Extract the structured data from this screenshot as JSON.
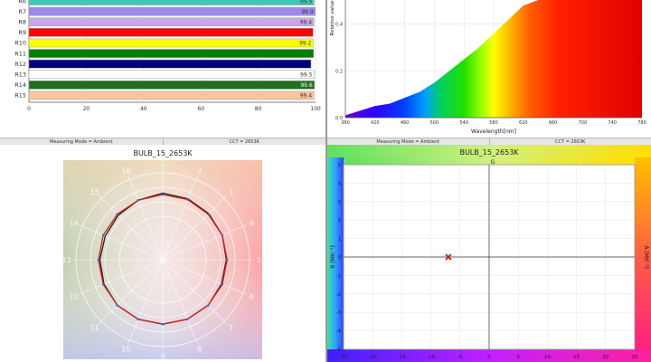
{
  "cri_chart": {
    "chart_data": {
      "type": "bar",
      "orientation": "horizontal",
      "categories": [
        "R6",
        "R7",
        "R8",
        "R9",
        "R10",
        "R11",
        "R12",
        "R13",
        "R14",
        "R15"
      ],
      "values": [
        99.5,
        99.9,
        99.4,
        99.1,
        99.2,
        99.3,
        98.4,
        99.5,
        99.6,
        99.4
      ],
      "value_labels": [
        "99.5",
        "99.9",
        "99.4",
        "",
        "99.2",
        "",
        "",
        "99.5",
        "99.6",
        "99.4"
      ],
      "colors": [
        "#40c8b4",
        "#9b8ae8",
        "#c7a8e8",
        "#ff0000",
        "#ffff00",
        "#008000",
        "#000080",
        "#ffffff",
        "#207020",
        "#f7c79c"
      ],
      "xlim": [
        0,
        100
      ],
      "xticks": [
        "0",
        "20",
        "40",
        "60",
        "80",
        "100"
      ]
    }
  },
  "spd_chart": {
    "chart_data": {
      "type": "area",
      "x": [
        380,
        400,
        420,
        440,
        460,
        480,
        500,
        520,
        540,
        560,
        580,
        600,
        620,
        640,
        660,
        680,
        700,
        720,
        740,
        760,
        780
      ],
      "y": [
        0.01,
        0.03,
        0.05,
        0.06,
        0.085,
        0.11,
        0.15,
        0.2,
        0.25,
        0.3,
        0.36,
        0.42,
        0.48,
        0.54,
        0.58,
        0.62,
        0.66,
        0.7,
        0.72,
        0.74,
        0.76
      ],
      "xlim": [
        380,
        780
      ],
      "ylim": [
        0,
        0.55
      ],
      "xticks": [
        "380",
        "420",
        "460",
        "500",
        "540",
        "580",
        "620",
        "660",
        "700",
        "740",
        "780"
      ],
      "yticks": [
        "0.0",
        "0.2",
        "0.4"
      ],
      "xlabel": "Wavelength[nm]",
      "ylabel": "Relative value"
    }
  },
  "status_left": {
    "mode": "Measuring Mode = Ambient",
    "cct": "CCT = 2653K"
  },
  "status_right": {
    "mode": "Measuring Mode = Ambient",
    "cct": "CCT = 2653K"
  },
  "cqs_chart": {
    "title": "BULB_15_2653K",
    "spokes": [
      "1",
      "2",
      "3",
      "4",
      "5",
      "6",
      "7",
      "8",
      "9",
      "10",
      "11",
      "12",
      "13",
      "14",
      "15",
      "16"
    ],
    "chart_data": {
      "type": "scatter",
      "series": [
        {
          "values": [
            0.92,
            0.91,
            0.9,
            0.89,
            0.88,
            0.88,
            0.89,
            0.89,
            0.89,
            0.89,
            0.89,
            0.88,
            0.87,
            0.86,
            0.87,
            0.89
          ]
        },
        {
          "values": [
            0.9,
            0.9,
            0.89,
            0.89,
            0.89,
            0.89,
            0.89,
            0.89,
            0.89,
            0.89,
            0.89,
            0.89,
            0.89,
            0.89,
            0.89,
            0.89
          ]
        }
      ]
    }
  },
  "duv_chart": {
    "title": "BULB_15_2653K",
    "top_label": "G",
    "right_label": "A [MK⁻¹]",
    "left_label": "B [MK⁻¹]",
    "chart_data": {
      "type": "scatter",
      "points": [
        {
          "x": -7,
          "y": 0
        }
      ],
      "xlim": [
        -25,
        25
      ],
      "ylim": [
        -5,
        5
      ],
      "xticks": [
        "-25",
        "-20",
        "-15",
        "-10",
        "-5",
        "0",
        "5",
        "10",
        "15",
        "20",
        "25"
      ],
      "yticks": [
        "-5",
        "-4",
        "-3",
        "-2",
        "-1",
        "0",
        "1",
        "2",
        "3",
        "4",
        "5"
      ]
    }
  }
}
